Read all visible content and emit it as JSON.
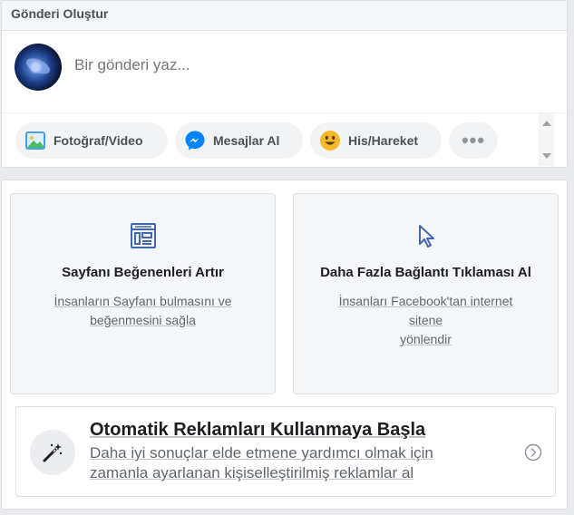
{
  "composer": {
    "header": "Gönderi Oluştur",
    "placeholder": "Bir gönderi yaz...",
    "actions": {
      "photo": "Fotoğraf/Video",
      "messages": "Mesajlar Al",
      "feeling": "His/Hareket",
      "more": "•••"
    }
  },
  "promos": {
    "likes": {
      "title": "Sayfanı Beğenenleri Artır",
      "desc_line1": "İnsanların Sayfanı bulmasını ve",
      "desc_line2": "beğenmesini sağla"
    },
    "clicks": {
      "title": "Daha Fazla Bağlantı Tıklaması Al",
      "desc_line1": "İnsanları Facebook'tan internet sitene",
      "desc_line2": "yönlendir"
    },
    "auto_ads": {
      "title": "Otomatik Reklamları Kullanmaya Başla",
      "desc_line1": "Daha iyi sonuçlar elde etmene yardımcı olmak için",
      "desc_line2": "zamanla ayarlanan kişiselleştirilmiş reklamlar al"
    }
  },
  "colors": {
    "accent": "#4267b2",
    "photo_icon": "#45bd62",
    "messenger": "#0084ff",
    "feeling_emoji": "#f7b928"
  }
}
